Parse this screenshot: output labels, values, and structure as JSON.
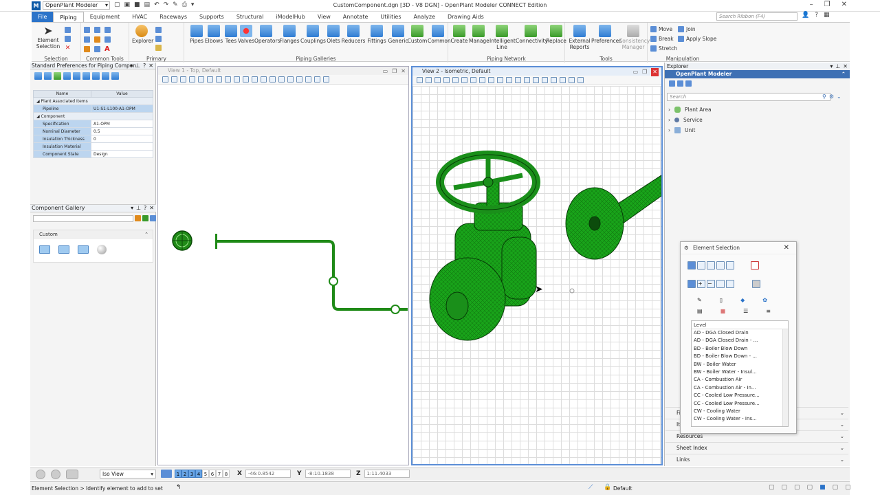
{
  "app": {
    "workflow": "OpenPlant Modeler",
    "window_title": "CustomComponent.dgn [3D - V8 DGN] - OpenPlant Modeler CONNECT Edition",
    "ribbon_search_placeholder": "Search Ribbon (F4)"
  },
  "tabs": [
    "File",
    "Piping",
    "Equipment",
    "HVAC",
    "Raceways",
    "Supports",
    "Structural",
    "iModelHub",
    "View",
    "Annotate",
    "Utilities",
    "Analyze",
    "Drawing Aids"
  ],
  "active_tab": "Piping",
  "ribbon": {
    "selection": {
      "label": "Selection",
      "element_selection": "Element Selection"
    },
    "common_tools": {
      "label": "Common Tools"
    },
    "primary": {
      "label": "Primary",
      "explorer": "Explorer"
    },
    "piping_galleries": {
      "label": "Piping Galleries",
      "items": [
        "Pipes",
        "Elbows",
        "Tees",
        "Valves",
        "Operators",
        "Flanges",
        "Couplings",
        "Olets",
        "Reducers",
        "Fittings",
        "Generic",
        "Custom",
        "Common"
      ]
    },
    "piping_network": {
      "label": "Piping Network",
      "items": [
        "Create",
        "Manage",
        "Intelligent Line",
        "Connectivity",
        "Replace"
      ]
    },
    "tools": {
      "label": "Tools",
      "items": [
        "External Reports",
        "Preferences",
        "Consistency Manager"
      ]
    },
    "manipulation": {
      "label": "Manipulation",
      "items": [
        "Move",
        "Join",
        "Break",
        "Apply Slope",
        "Stretch"
      ]
    }
  },
  "preferences_panel": {
    "title": "Standard Preferences for Piping Compon",
    "columns": [
      "Name",
      "Value"
    ],
    "categories": [
      {
        "name": "Plant Associated Items",
        "rows": [
          {
            "k": "Pipeline",
            "v": "U1-S1-L100-A1-OPM"
          }
        ]
      },
      {
        "name": "Component",
        "rows": [
          {
            "k": "Specification",
            "v": "A1-OPM"
          },
          {
            "k": "Nominal Diameter",
            "v": "0.5"
          },
          {
            "k": "Insulation Thickness",
            "v": "0"
          },
          {
            "k": "Insulation Material",
            "v": ""
          },
          {
            "k": "Component State",
            "v": "Design"
          }
        ]
      }
    ]
  },
  "gallery_panel": {
    "title": "Component Gallery",
    "section": "Custom"
  },
  "views": {
    "view1_title": "View 1 - Top, Default",
    "view2_title": "View 2 - Isometric, Default"
  },
  "explorer": {
    "title": "Explorer",
    "root": "OpenPlant Modeler",
    "search_placeholder": "Search",
    "tree": [
      "Plant Area",
      "Service",
      "Unit"
    ],
    "accordions": [
      "Fi",
      "It",
      "Resources",
      "Sheet Index",
      "Links"
    ]
  },
  "element_selection": {
    "title": "Element Selection",
    "list_header": "Level",
    "levels": [
      "AD - DGA Closed Drain",
      "AD - DGA Closed Drain - ...",
      "BD - Boiler Blow Down",
      "BD - Boiler Blow Down - ...",
      "BW - Boiler Water",
      "BW - Boiler Water - Insul...",
      "CA - Combustion Air",
      "CA - Combustion Air - In...",
      "CC - Cooled Low Pressure...",
      "CC - Cooled Low Pressure...",
      "CW - Cooling Water",
      "CW - Cooling Water - Ins..."
    ]
  },
  "bottom": {
    "view_mode": "Iso View",
    "view_numbers": [
      "1",
      "2",
      "3",
      "4",
      "5",
      "6",
      "7",
      "8"
    ],
    "x_label": "X",
    "x_value": "-46:0.8542",
    "y_label": "Y",
    "y_value": "-8:10.1838",
    "z_label": "Z",
    "z_value": "1:11.4033",
    "status_prompt": "Element Selection > Identify element to add to set",
    "level": "Default"
  },
  "colors": {
    "pipe_green": "#1f8a17",
    "accent_blue": "#2b73c9"
  }
}
